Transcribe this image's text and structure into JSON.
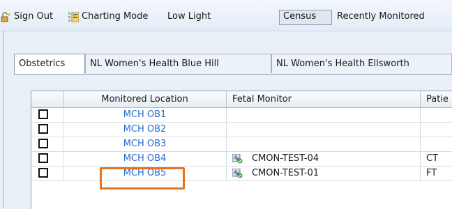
{
  "toolbar": {
    "sign_out_label": "Sign Out",
    "charting_mode_label": "Charting Mode",
    "low_light_label": "Low Light",
    "census_label": "Census",
    "recently_monitored_label": "Recently Monitored"
  },
  "tabs": [
    {
      "label": "Obstetrics",
      "active": true
    },
    {
      "label": "NL Women's Health Blue Hill",
      "active": false
    },
    {
      "label": "NL Women's Health Ellsworth",
      "active": false
    }
  ],
  "grid": {
    "columns": [
      "",
      "Monitored Location",
      "Fetal Monitor",
      "Patie"
    ],
    "rows": [
      {
        "checked": false,
        "location": "MCH OB1",
        "fetal_monitor": "",
        "patient": ""
      },
      {
        "checked": false,
        "location": "MCH OB2",
        "fetal_monitor": "",
        "patient": ""
      },
      {
        "checked": false,
        "location": "MCH OB3",
        "fetal_monitor": "",
        "patient": ""
      },
      {
        "checked": false,
        "location": "MCH OB4",
        "fetal_monitor": "CMON-TEST-04",
        "patient": "CT"
      },
      {
        "checked": false,
        "location": "MCH OB5",
        "fetal_monitor": "CMON-TEST-01",
        "patient": "FT"
      }
    ]
  },
  "colors": {
    "link": "#2a6bd1",
    "highlight": "#e8731c",
    "background": "#e9f0f8"
  },
  "icons": {
    "sign_out": "sign-out-icon",
    "charting_mode": "charting-mode-icon",
    "fetal_monitor": "fetal-monitor-icon"
  }
}
